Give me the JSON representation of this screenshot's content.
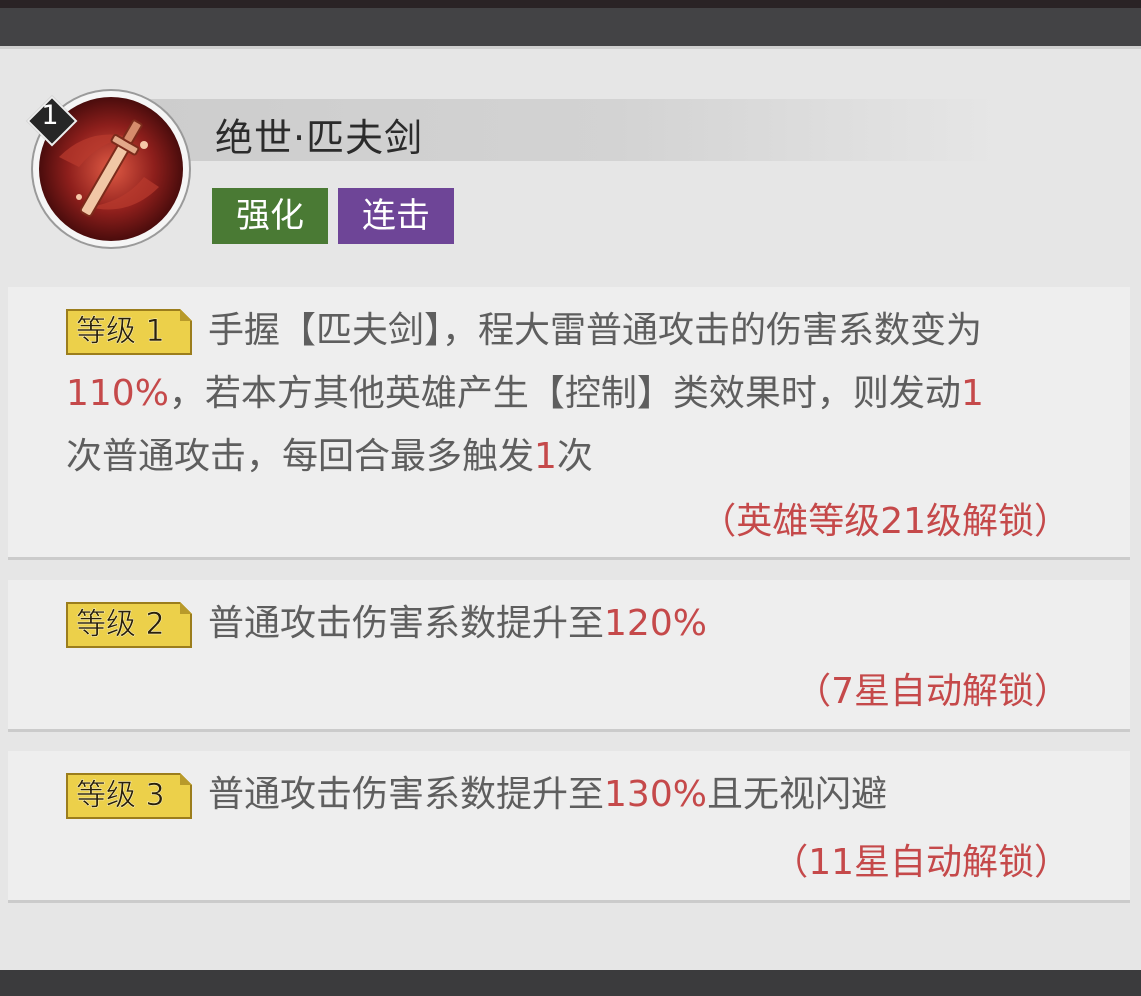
{
  "skill": {
    "level_number": "1",
    "title": "绝世·匹夫剑",
    "tags": [
      "强化",
      "连击"
    ]
  },
  "levels": [
    {
      "badge": "等级 1",
      "lines": [
        [
          "手握【匹夫剑】，程大雷普通攻击的伤害系数变为"
        ],
        [
          "110%",
          "，若本方其他英雄产生【控制】类效果时，则发动",
          "1"
        ],
        [
          "次普通攻击，每回合最多触发",
          "1",
          "次"
        ]
      ],
      "unlock": "（英雄等级21级解锁）"
    },
    {
      "badge": "等级 2",
      "text": "普通攻击伤害系数提升至",
      "value": "120%",
      "suffix": "",
      "unlock": "（7星自动解锁）"
    },
    {
      "badge": "等级 3",
      "text": "普通攻击伤害系数提升至",
      "value": "130%",
      "suffix": "且无视闪避",
      "unlock": "（11星自动解锁）"
    }
  ],
  "colors": {
    "highlight": "#c5494a",
    "tag_enhance": "#4a7a34",
    "tag_combo": "#6e4597",
    "level_badge": "#ecd04a"
  },
  "icons": {
    "skill_icon": "sword-skill-icon",
    "level_marker": "diamond-level-icon"
  }
}
